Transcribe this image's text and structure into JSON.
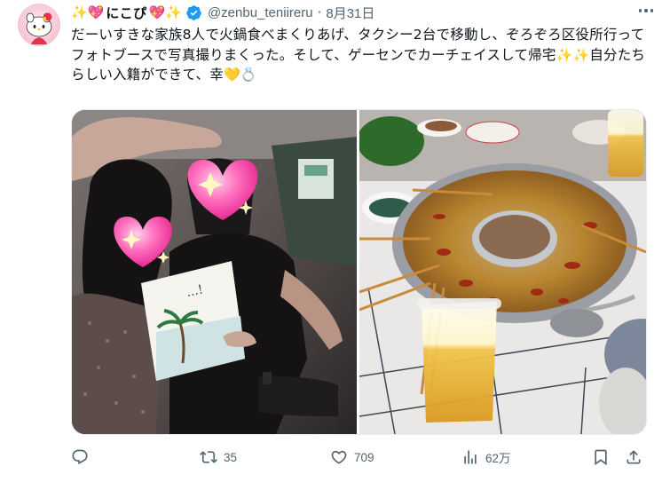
{
  "author": {
    "display_name": "にこぴ",
    "handle": "@zenbu_teniireru",
    "separator": "·",
    "date": "8月31日"
  },
  "tweet": {
    "text_part1": "だーいすきな家族8人で火鍋食べまくりあげ、タクシー2台で移動し、ぞろぞろ区役所行ってフォトブースで写真撮りまくった。そして、ゲーセンでカーチェイスして帰宅",
    "text_part2": "自分たちらしい入籍ができて、幸"
  },
  "photo_left": {
    "book_title": "...!"
  },
  "actions": {
    "reply_icon": "reply-icon",
    "retweet_count": "35",
    "like_count": "709",
    "views_count": "62万"
  },
  "colors": {
    "text": "#0f1419",
    "muted": "#536471",
    "verified": "#1d9bf0",
    "heart_pink": "#ff4fa3"
  }
}
